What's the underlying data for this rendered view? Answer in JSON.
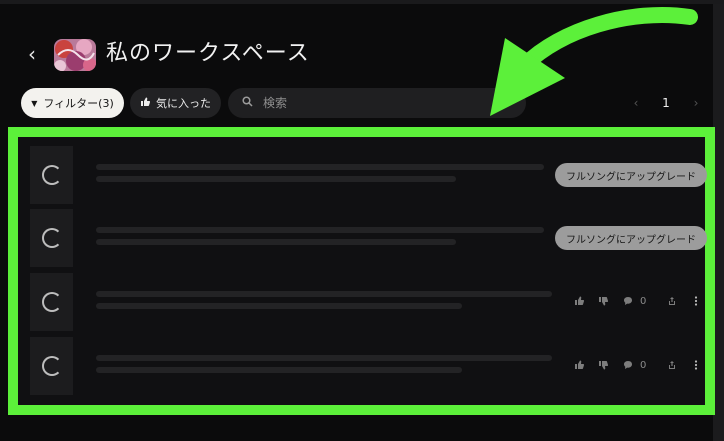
{
  "header": {
    "back_icon": "chevron-left-icon",
    "title": "私のワークスペース"
  },
  "toolbar": {
    "filter_label": "フィルター(3)",
    "filter_icon": "funnel-icon",
    "favorites_label": "気に入った",
    "favorites_icon": "thumbs-up-icon",
    "search_placeholder": "検索",
    "search_value": "",
    "search_icon": "search-icon"
  },
  "pagination": {
    "current_page": "1"
  },
  "songs": [
    {
      "status": "loading",
      "upgrade_label": "フルソングにアップグレード"
    },
    {
      "status": "loading",
      "upgrade_label": "フルソングにアップグレード"
    },
    {
      "status": "loading",
      "comment_count": "0"
    },
    {
      "status": "loading",
      "comment_count": "0"
    }
  ],
  "colors": {
    "background": "#0b0b0c",
    "highlight_annotation": "#5cf03a",
    "filter_button_bg": "#f3f2ee",
    "upgrade_button_bg": "#9c9c9c"
  },
  "annotation": {
    "type": "green-arrow-pointing-to-list",
    "highlight": "green-box-around-song-list"
  }
}
